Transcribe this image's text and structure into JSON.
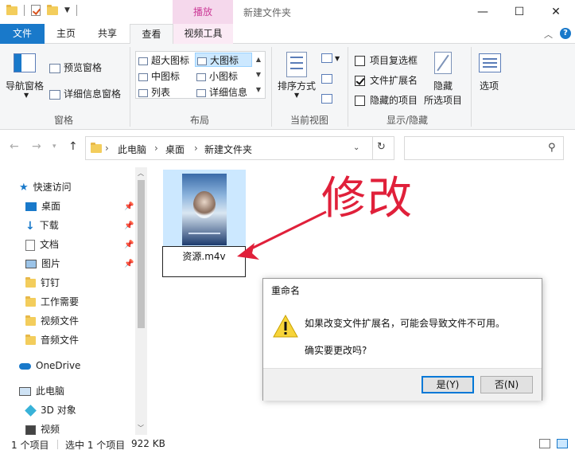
{
  "titlebar": {
    "context_tab": "播放",
    "window_title": "新建文件夹",
    "minimize": "—",
    "maximize": "☐",
    "close": "✕"
  },
  "tabs": {
    "file": "文件",
    "home": "主页",
    "share": "共享",
    "view": "查看",
    "video_tools": "视频工具"
  },
  "ribbon": {
    "panes": {
      "navigation_pane": "导航窗格",
      "preview_pane": "预览窗格",
      "details_pane": "详细信息窗格",
      "group_label": "窗格"
    },
    "layout": {
      "extra_large": "超大图标",
      "large": "大图标",
      "medium": "中图标",
      "small": "小图标",
      "list": "列表",
      "details": "详细信息",
      "group_label": "布局"
    },
    "current_view": {
      "sort_by": "排序方式",
      "group_label": "当前视图"
    },
    "show_hide": {
      "item_checkboxes": "项目复选框",
      "item_checkboxes_checked": false,
      "file_extensions": "文件扩展名",
      "file_extensions_checked": true,
      "hidden_items": "隐藏的项目",
      "hidden_items_checked": false,
      "hide_selected_1": "隐藏",
      "hide_selected_2": "所选项目",
      "group_label": "显示/隐藏"
    },
    "options": "选项"
  },
  "address": {
    "crumbs": [
      "此电脑",
      "桌面",
      "新建文件夹"
    ]
  },
  "navpane": {
    "quick_access": "快速访问",
    "items": [
      "桌面",
      "下载",
      "文档",
      "图片",
      "钉钉",
      "工作需要",
      "视频文件",
      "音频文件"
    ],
    "onedrive": "OneDrive",
    "this_pc": "此电脑",
    "pc_items": [
      "3D 对象",
      "视频"
    ]
  },
  "content": {
    "rename_value": "资源.m4v",
    "annotation": "修改"
  },
  "dialog": {
    "title": "重命名",
    "message1": "如果改变文件扩展名，可能会导致文件不可用。",
    "message2": "确实要更改吗?",
    "yes": "是(Y)",
    "no": "否(N)"
  },
  "status": {
    "count": "1 个项目",
    "selected": "选中 1 个项目",
    "size": "922 KB"
  },
  "colors": {
    "accent": "#1979ca",
    "video_tools_tint": "#cc3c98",
    "annotation": "#e0203a",
    "selection": "#cce8ff"
  }
}
